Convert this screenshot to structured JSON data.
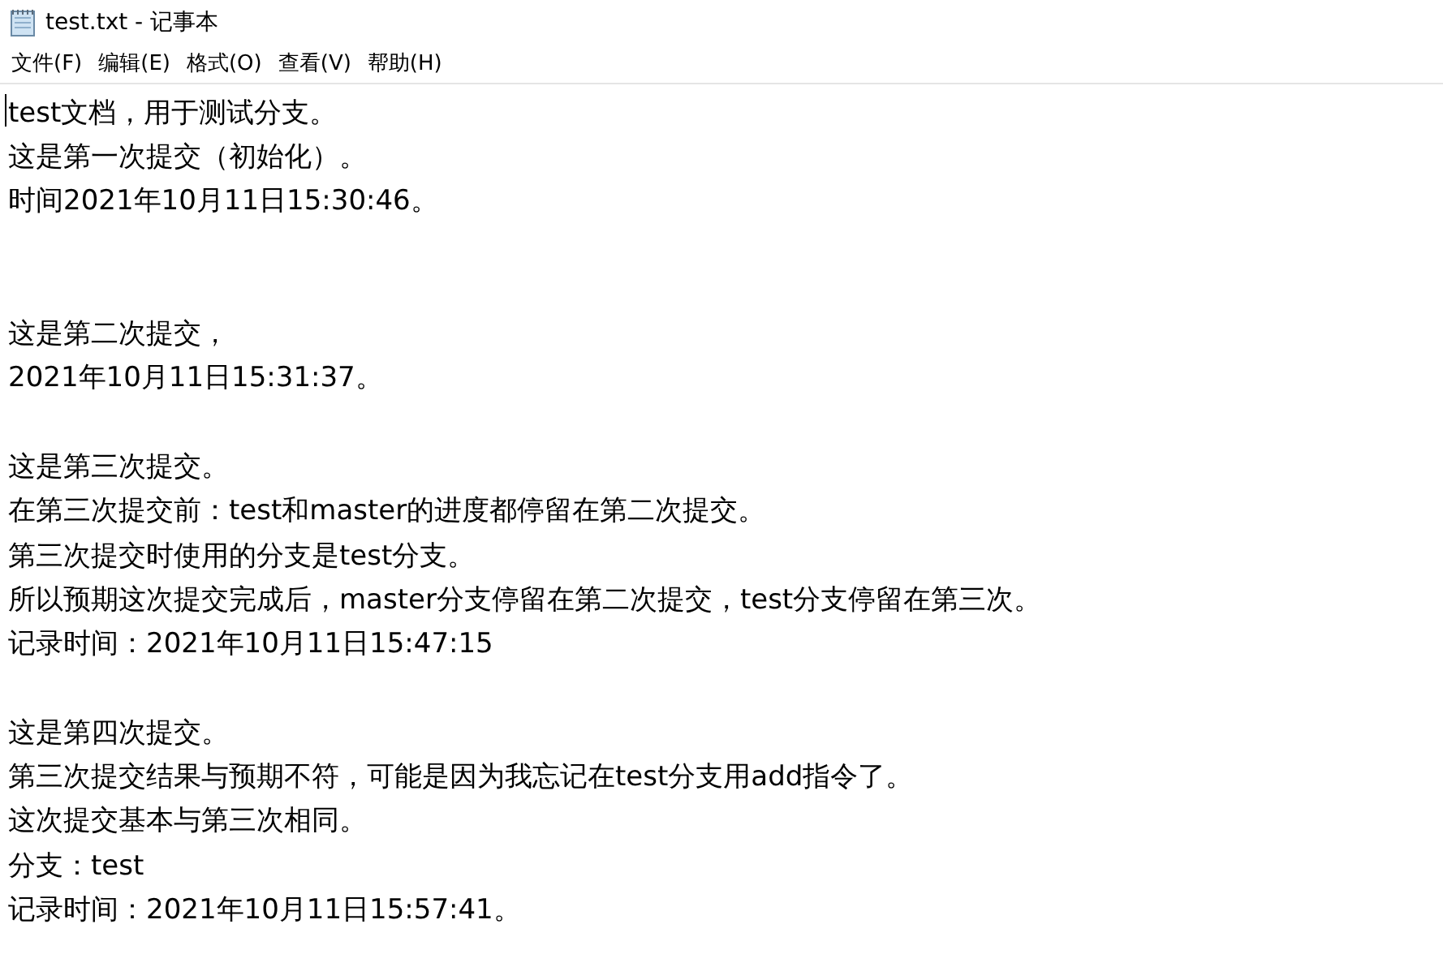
{
  "window": {
    "title": "test.txt - 记事本"
  },
  "menu": [
    {
      "label": "文件(F)"
    },
    {
      "label": "编辑(E)"
    },
    {
      "label": "格式(O)"
    },
    {
      "label": "查看(V)"
    },
    {
      "label": "帮助(H)"
    }
  ],
  "document": {
    "lines": [
      {
        "kind": "text",
        "text": "test文档，用于测试分支。"
      },
      {
        "kind": "text",
        "text": "这是第一次提交（初始化）。"
      },
      {
        "kind": "text",
        "text": "时间2021年10月11日15:30:46。"
      },
      {
        "kind": "blank"
      },
      {
        "kind": "blank"
      },
      {
        "kind": "text",
        "text": "这是第二次提交，"
      },
      {
        "kind": "text",
        "text": "2021年10月11日15:31:37。"
      },
      {
        "kind": "blank"
      },
      {
        "kind": "text",
        "text": "这是第三次提交。"
      },
      {
        "kind": "text",
        "text": "在第三次提交前：test和master的进度都停留在第二次提交。"
      },
      {
        "kind": "text",
        "text": "第三次提交时使用的分支是test分支。"
      },
      {
        "kind": "text",
        "text": "所以预期这次提交完成后，master分支停留在第二次提交，test分支停留在第三次。"
      },
      {
        "kind": "text",
        "text": "记录时间：2021年10月11日15:47:15"
      },
      {
        "kind": "blank"
      },
      {
        "kind": "text",
        "text": "这是第四次提交。"
      },
      {
        "kind": "text",
        "text": "第三次提交结果与预期不符，可能是因为我忘记在test分支用add指令了。"
      },
      {
        "kind": "text",
        "text": "这次提交基本与第三次相同。"
      },
      {
        "kind": "text",
        "text": "分支：test"
      },
      {
        "kind": "text",
        "text": "记录时间：2021年10月11日15:57:41。"
      }
    ]
  }
}
